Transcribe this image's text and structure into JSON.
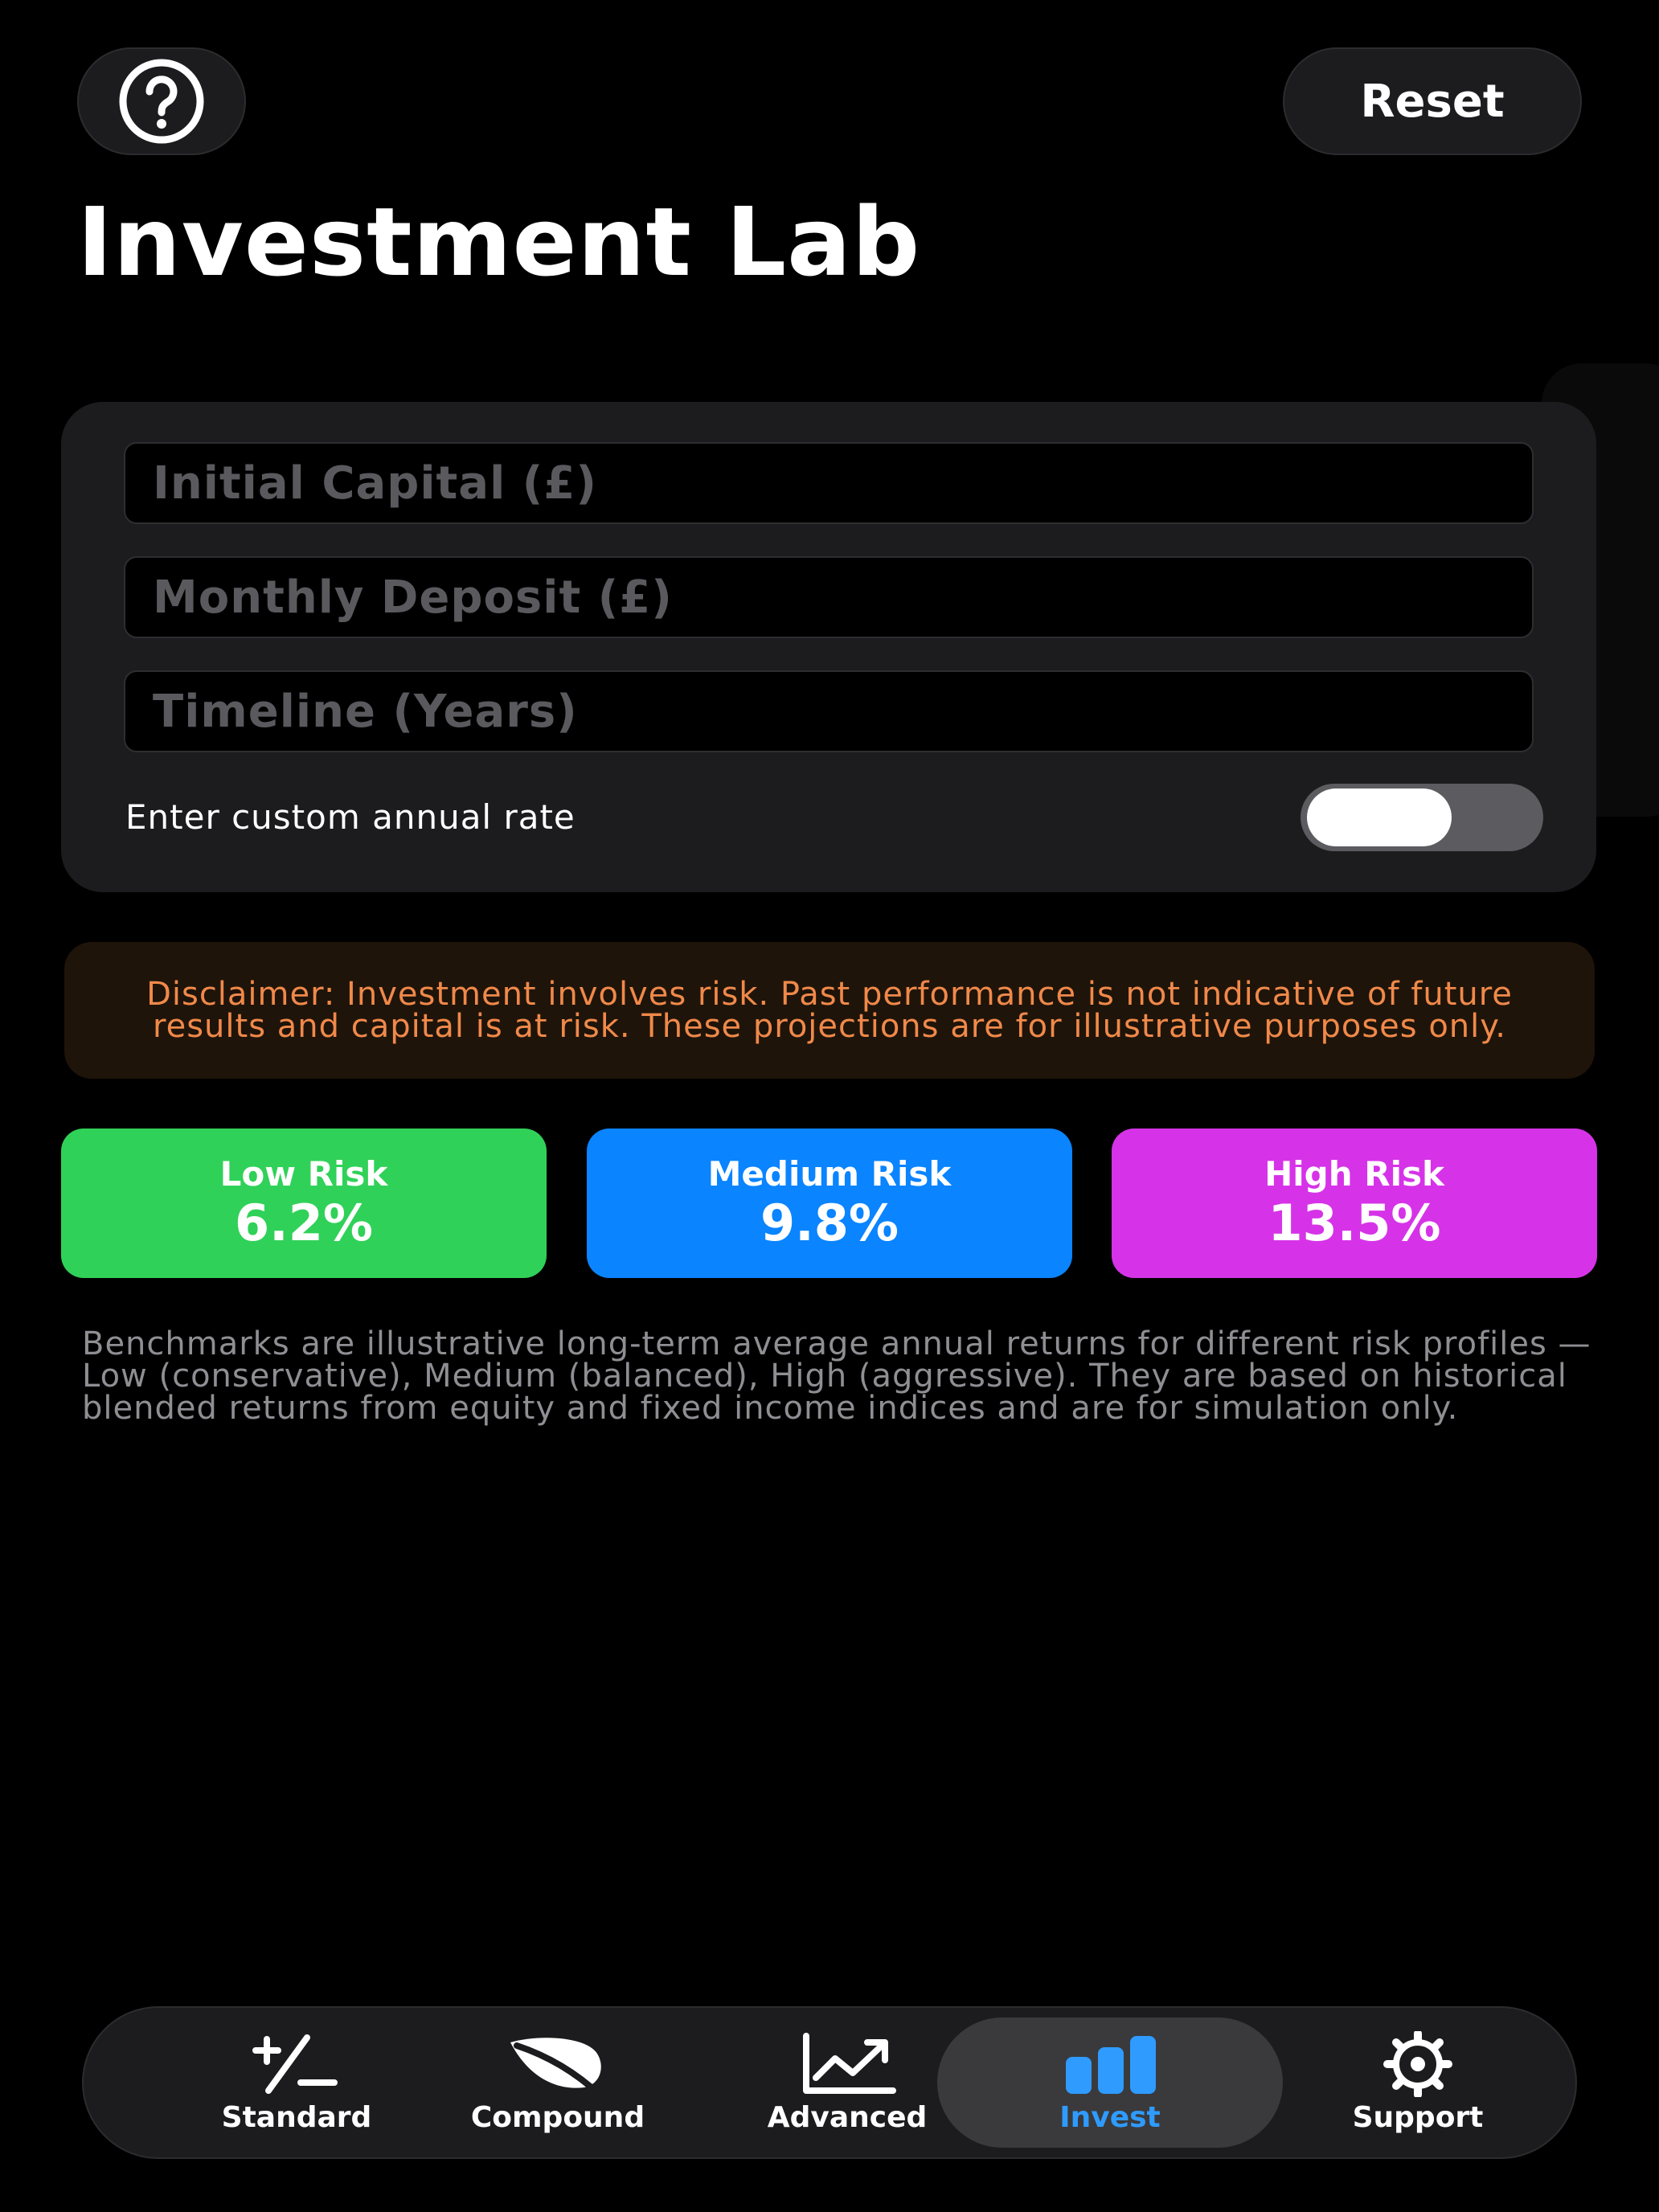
{
  "header": {
    "help_icon": "question-circle-icon",
    "reset_label": "Reset",
    "title": "Investment Lab"
  },
  "inputs": {
    "initial_capital": {
      "value": "",
      "placeholder": "Initial Capital (£)"
    },
    "monthly_deposit": {
      "value": "",
      "placeholder": "Monthly Deposit (£)"
    },
    "timeline": {
      "value": "",
      "placeholder": "Timeline (Years)"
    },
    "custom_rate_label": "Enter custom annual rate",
    "custom_rate_enabled": false
  },
  "disclaimer": "Disclaimer: Investment involves risk. Past performance is not indicative of future results and capital is at risk. These projections are for illustrative purposes only.",
  "risk_profiles": [
    {
      "label": "Low Risk",
      "rate": "6.2%",
      "color": "#30d158"
    },
    {
      "label": "Medium Risk",
      "rate": "9.8%",
      "color": "#0a84ff"
    },
    {
      "label": "High Risk",
      "rate": "13.5%",
      "color": "#d633e8"
    }
  ],
  "benchmarks_note": "Benchmarks are illustrative long-term average annual returns for different risk profiles — Low (conservative), Medium (balanced), High (aggressive). They are based on historical blended returns from equity and fixed income indices and are for simulation only.",
  "tab_bar": {
    "tabs": [
      {
        "label": "Standard",
        "icon": "plus-minus-icon",
        "active": false
      },
      {
        "label": "Compound",
        "icon": "leaf-icon",
        "active": false
      },
      {
        "label": "Advanced",
        "icon": "line-chart-icon",
        "active": false
      },
      {
        "label": "Invest",
        "icon": "bar-chart-icon",
        "active": true
      },
      {
        "label": "Support",
        "icon": "gear-icon",
        "active": false
      }
    ],
    "active_color": "#2f9bff"
  },
  "colors": {
    "background": "#000000",
    "card": "#1c1c1e",
    "disclaimer_text": "#f0894a",
    "disclaimer_bg": "#1f1409"
  }
}
